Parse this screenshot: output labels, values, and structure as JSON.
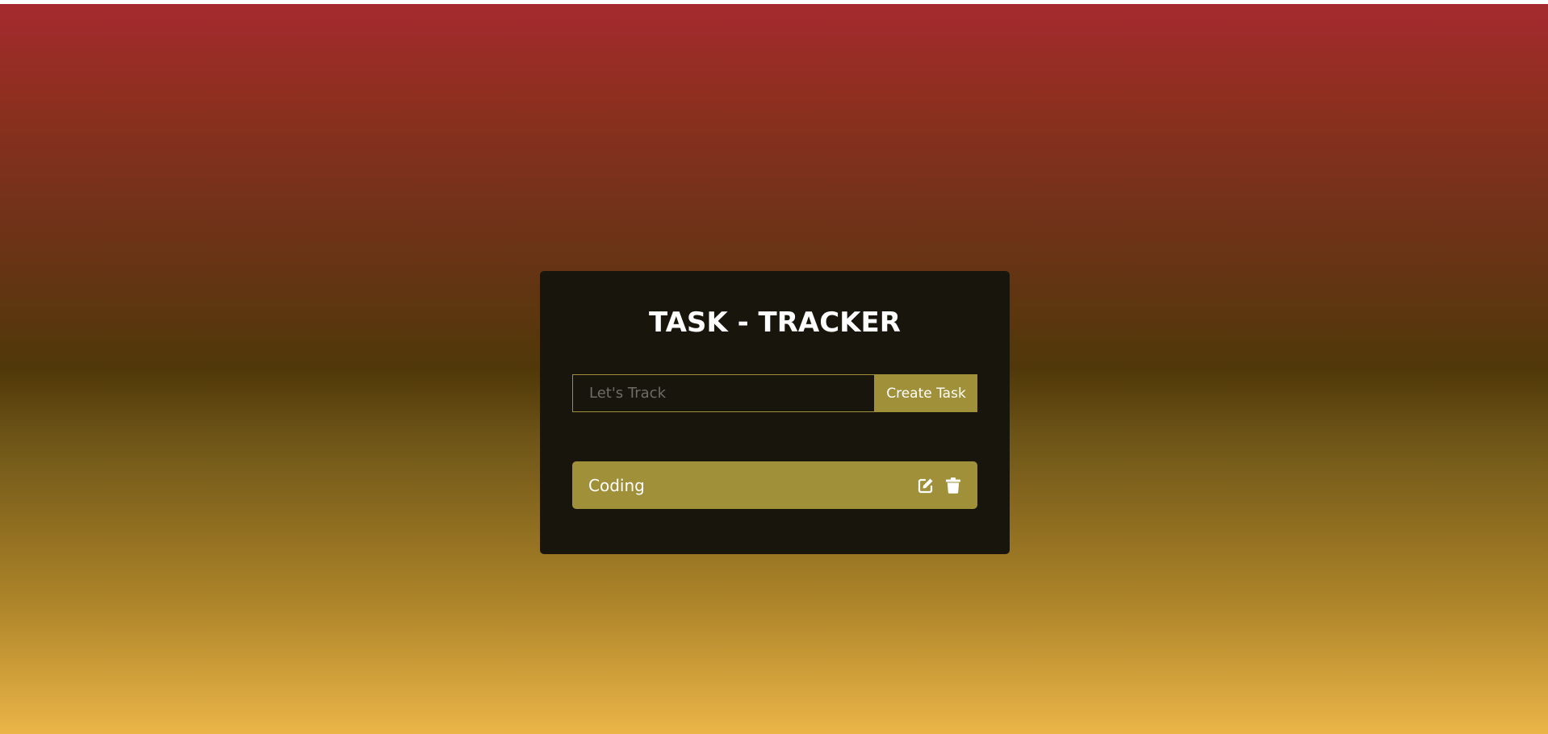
{
  "app": {
    "title": "TASK - TRACKER"
  },
  "form": {
    "input_placeholder": "Let's Track",
    "input_value": "",
    "create_label": "Create Task"
  },
  "tasks": [
    {
      "label": "Coding",
      "actions": [
        "edit-icon",
        "trash-icon"
      ]
    }
  ],
  "colors": {
    "card_background": "#18150c",
    "accent": "#a1903a",
    "text": "#ffffff",
    "gradient_top": "#a52a2e",
    "gradient_middle": "#503809",
    "gradient_bottom": "#ebb548"
  }
}
